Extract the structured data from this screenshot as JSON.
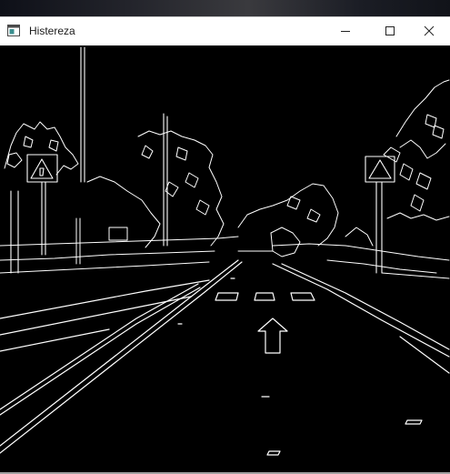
{
  "window": {
    "title": "Histereza"
  },
  "icons": {
    "app": "app-window-icon",
    "minimize": "minimize-icon",
    "maximize": "maximize-icon",
    "close": "close-icon"
  },
  "colors": {
    "titlebar_bg": "#ffffff",
    "canvas_bg": "#000000",
    "edge_stroke": "#ffffff"
  }
}
